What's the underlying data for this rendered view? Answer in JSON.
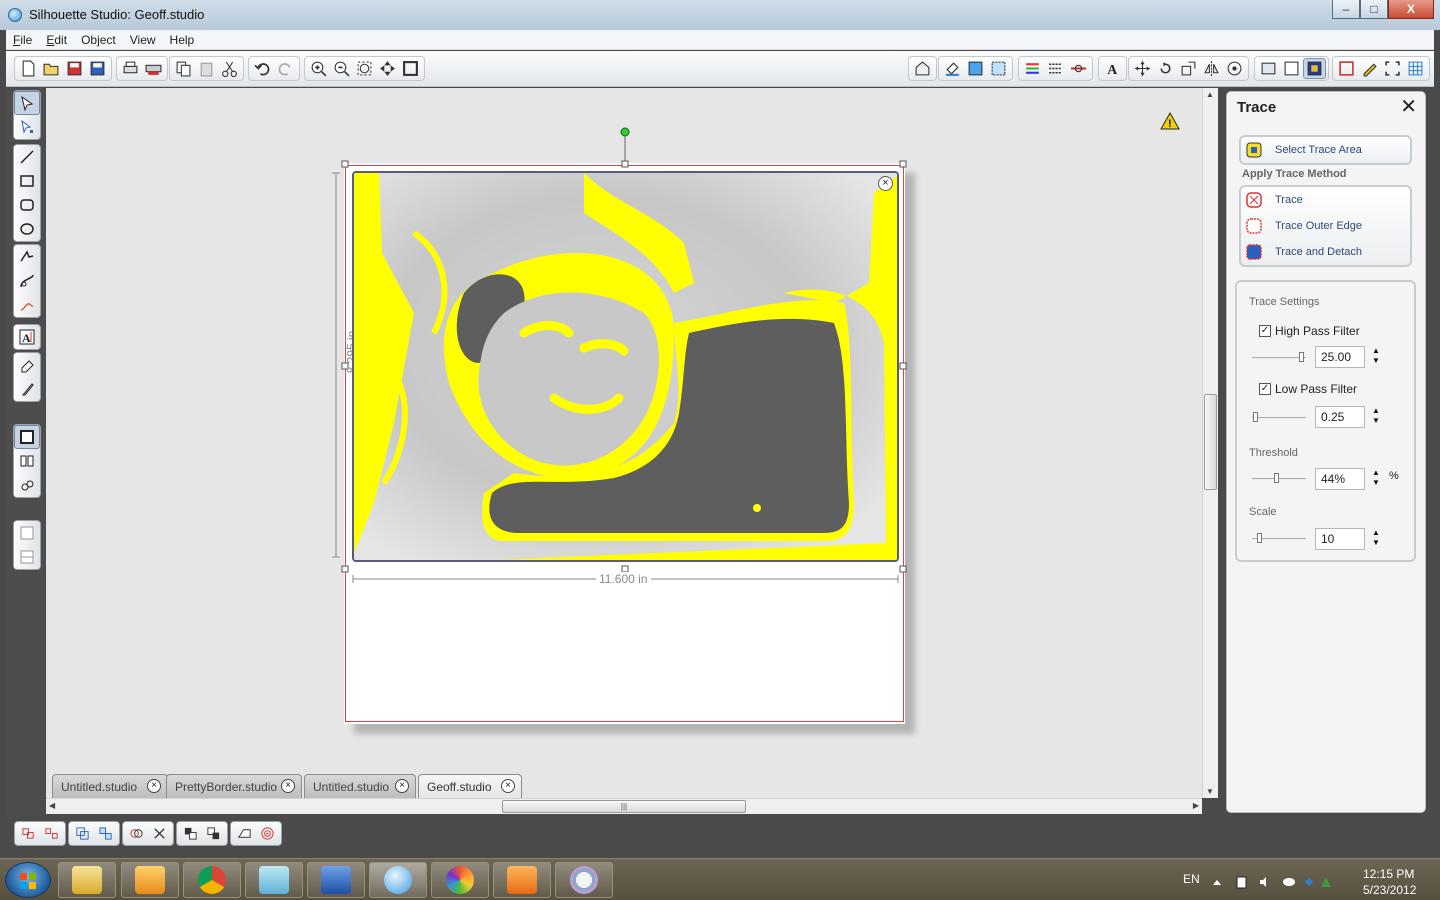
{
  "window": {
    "title": "Silhouette Studio: Geoff.studio",
    "minimize": "–",
    "maximize": "□",
    "close": "X"
  },
  "menu": [
    {
      "first": "F",
      "rest": "ile"
    },
    {
      "first": "E",
      "rest": "dit"
    },
    {
      "first": "",
      "rest": "Object"
    },
    {
      "first": "",
      "rest": "View"
    },
    {
      "first": "",
      "rest": "Help"
    }
  ],
  "canvas": {
    "height_label": "8.295 in",
    "width_label": "11.600 in",
    "image_close": "×",
    "warning": "!"
  },
  "tabs": [
    {
      "label": "Untitled.studio",
      "close": "×"
    },
    {
      "label": "PrettyBorder.studio",
      "close": "×"
    },
    {
      "label": "Untitled.studio",
      "close": "×"
    },
    {
      "label": "Geoff.studio",
      "close": "×",
      "active": true
    }
  ],
  "trace_panel": {
    "title": "Trace",
    "close": "✕",
    "select_area": "Select Trace Area",
    "apply_method_label": "Apply Trace Method",
    "methods": [
      "Trace",
      "Trace Outer Edge",
      "Trace and Detach"
    ],
    "settings_label": "Trace Settings",
    "high_pass": {
      "label": "High Pass Filter",
      "checked": true,
      "value": "25.00",
      "slider": 0.95
    },
    "low_pass": {
      "label": "Low Pass Filter",
      "checked": true,
      "value": "0.25",
      "slider": 0.02
    },
    "threshold": {
      "label": "Threshold",
      "value": "44%",
      "unit": "%",
      "slider": 0.44
    },
    "scale": {
      "label": "Scale",
      "value": "10",
      "slider": 0.1
    }
  },
  "taskbar": {
    "language": "EN",
    "time": "12:15 PM",
    "date": "5/23/2012"
  },
  "colors": {
    "trace_highlight": "#ffff00",
    "title_bar": "#c4d5e4",
    "canvas_bg": "#e6e6e6",
    "page_border": "#dd4444"
  }
}
